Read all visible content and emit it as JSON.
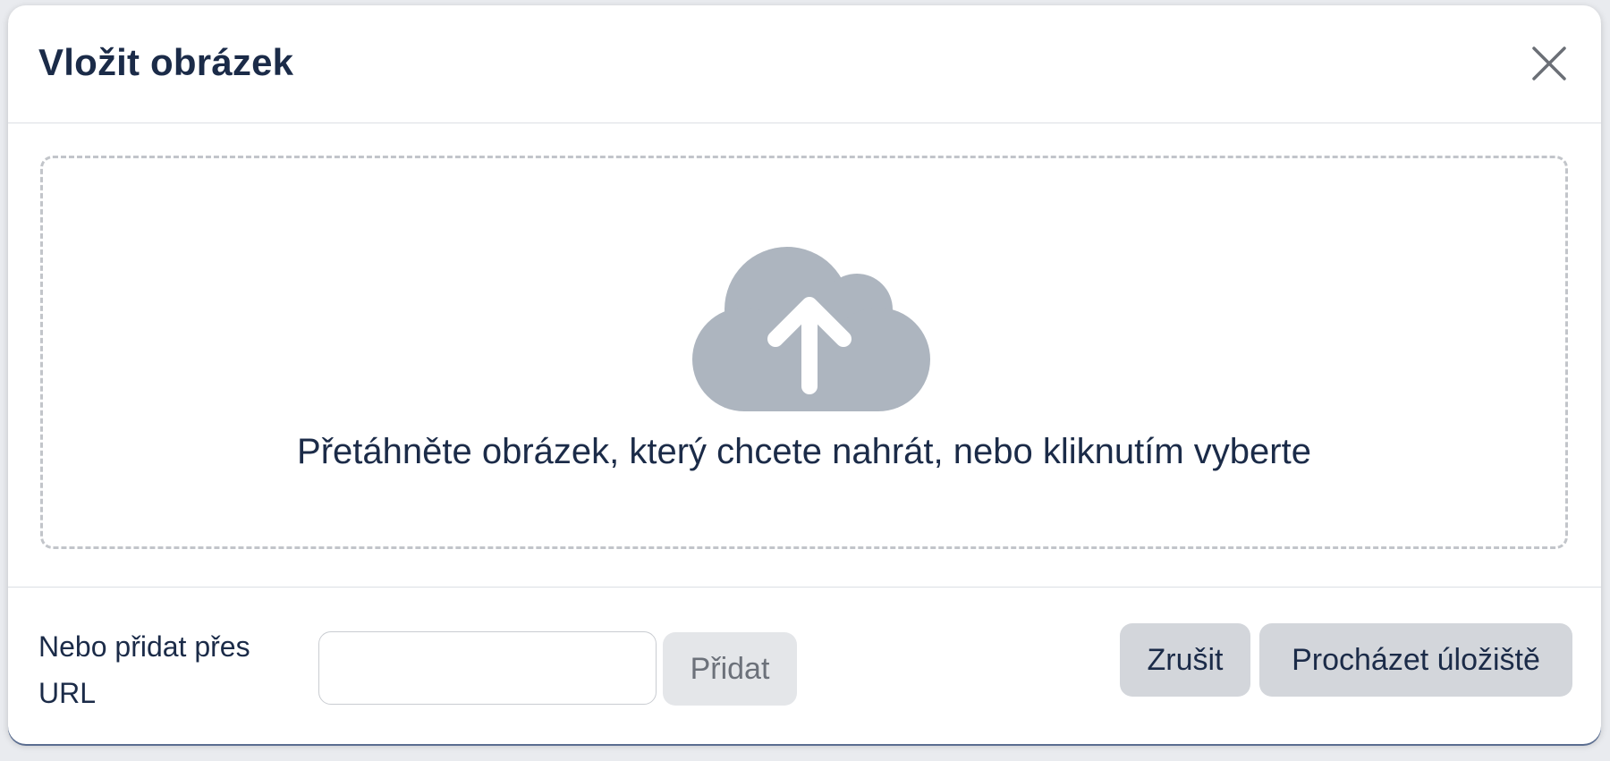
{
  "dialog": {
    "title": "Vložit obrázek"
  },
  "dropzone": {
    "icon": "cloud-upload-icon",
    "text": "Přetáhněte obrázek, který chcete nahrát, nebo kliknutím vyberte"
  },
  "footer": {
    "url_label": "Nebo přidat přes URL",
    "url_input_value": "",
    "add_label": "Přidat",
    "cancel_label": "Zrušit",
    "browse_label": "Procházet úložiště"
  },
  "colors": {
    "text": "#1b2b48",
    "icon": "#adb5bf",
    "button_bg": "#d3d6db",
    "disabled_button_bg": "#e4e6e9"
  }
}
